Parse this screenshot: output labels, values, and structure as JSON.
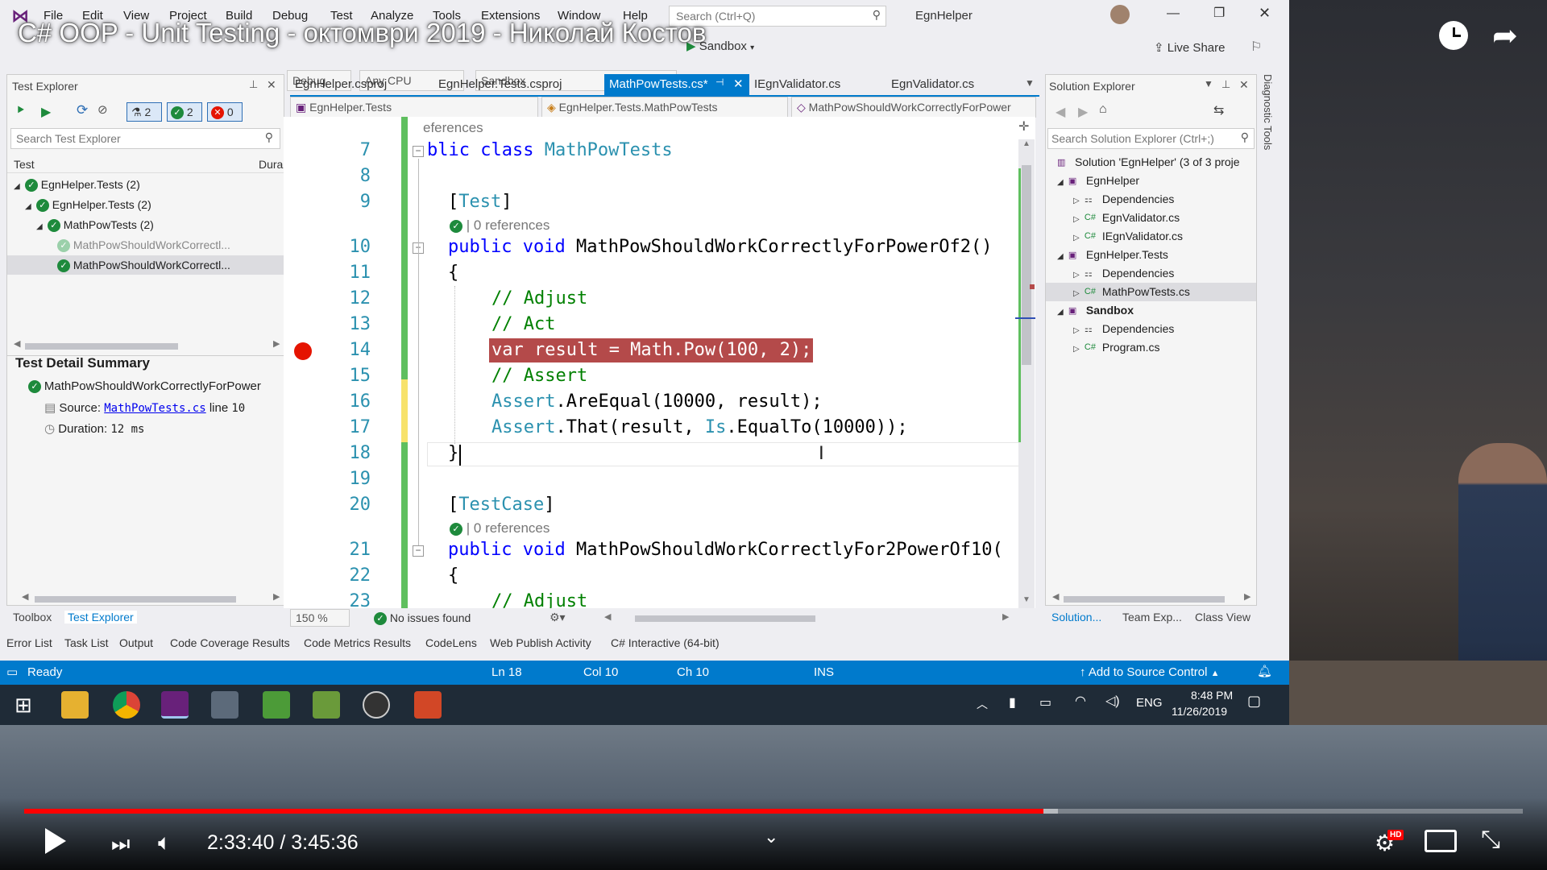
{
  "video": {
    "title": "C# OOP - Unit Testing - октомври 2019 - Николай Костов",
    "time_current": "2:33:40",
    "time_separator": "/",
    "time_total": "3:45:36",
    "progress_fraction": 0.68,
    "buffered_fraction": 0.69,
    "hd_badge": "HD"
  },
  "vs": {
    "menu": [
      "File",
      "Edit",
      "View",
      "Project",
      "Build",
      "Debug",
      "Test",
      "Analyze",
      "Tools",
      "Extensions",
      "Window",
      "Help"
    ],
    "search_placeholder": "Search (Ctrl+Q)",
    "solution_name": "EgnHelper",
    "toolbar": {
      "config": "Debug",
      "platform": "Any CPU",
      "startup": "Sandbox",
      "run_label": "Sandbox",
      "live_share": "Live Share"
    },
    "test_explorer": {
      "title": "Test Explorer",
      "count_total": "2",
      "count_passed": "2",
      "count_failed": "0",
      "search_placeholder": "Search Test Explorer",
      "col_test": "Test",
      "col_duration": "Dura",
      "tree": [
        {
          "label": "EgnHelper.Tests (2)"
        },
        {
          "label": "EgnHelper.Tests (2)"
        },
        {
          "label": "MathPowTests (2)"
        },
        {
          "label": "MathPowShouldWorkCorrectl..."
        },
        {
          "label": "MathPowShouldWorkCorrectl..."
        }
      ],
      "detail_title": "Test Detail Summary",
      "detail_test": "MathPowShouldWorkCorrectlyForPower",
      "detail_source_label": "Source:",
      "detail_source_file": "MathPowTests.cs",
      "detail_source_line_label": "line",
      "detail_source_line": "10",
      "detail_duration_label": "Duration:",
      "detail_duration": "12 ms"
    },
    "tabs": [
      {
        "label": "EgnHelper.csproj"
      },
      {
        "label": "EgnHelper.Tests.csproj"
      },
      {
        "label": "MathPowTests.cs*"
      },
      {
        "label": "IEgnValidator.cs"
      },
      {
        "label": "EgnValidator.cs"
      }
    ],
    "nav": {
      "project": "EgnHelper.Tests",
      "class": "EgnHelper.Tests.MathPowTests",
      "member": "MathPowShouldWorkCorrectlyForPower"
    },
    "editor": {
      "partial_top": "eferences",
      "lines": {
        "l7": "7",
        "l8": "8",
        "l9": "9",
        "l10": "10",
        "l11": "11",
        "l12": "12",
        "l13": "13",
        "l14": "14",
        "l15": "15",
        "l16": "16",
        "l17": "17",
        "l18": "18",
        "l19": "19",
        "l20": "20",
        "l21": "21",
        "l22": "22",
        "l23": "23"
      },
      "code": {
        "c7_kw": "blic class ",
        "c7_ty": "MathPowTests",
        "c9_open": "[",
        "c9_attr": "Test",
        "c9_close": "]",
        "c9_lens": "0 references",
        "c10_kw": "public void ",
        "c10_name": "MathPowShouldWorkCorrectlyForPowerOf2()",
        "c11": "{",
        "c12": "// Adjust",
        "c13": "// Act",
        "c14": "var result = Math.Pow(100, 2);",
        "c15": "// Assert",
        "c16_ty": "Assert",
        "c16_rest": ".AreEqual(10000, result);",
        "c17_ty": "Assert",
        "c17_mid": ".That(result, ",
        "c17_ty2": "Is",
        "c17_rest": ".EqualTo(10000));",
        "c18": "}",
        "c20_open": "[",
        "c20_attr": "TestCase",
        "c20_close": "]",
        "c20_lens": "0 references",
        "c21_kw": "public void ",
        "c21_name": "MathPowShouldWorkCorrectlyFor2PowerOf10(",
        "c22": "{",
        "c23": "// Adjust"
      },
      "zoom": "150 %",
      "issues": "No issues found",
      "lens_sep": "|"
    },
    "solution_explorer": {
      "title": "Solution Explorer",
      "search_placeholder": "Search Solution Explorer (Ctrl+;)",
      "items": [
        {
          "label": "Solution 'EgnHelper' (3 of 3 proje"
        },
        {
          "label": "EgnHelper"
        },
        {
          "label": "Dependencies"
        },
        {
          "label": "EgnValidator.cs"
        },
        {
          "label": "IEgnValidator.cs"
        },
        {
          "label": "EgnHelper.Tests"
        },
        {
          "label": "Dependencies"
        },
        {
          "label": "MathPowTests.cs"
        },
        {
          "label": "Sandbox"
        },
        {
          "label": "Dependencies"
        },
        {
          "label": "Program.cs"
        }
      ],
      "bottom_tabs": [
        "Solution...",
        "Team Exp...",
        "Class View"
      ],
      "diagnostic_tools": "Diagnostic Tools"
    },
    "left_bottom_tabs": [
      "Toolbox",
      "Test Explorer"
    ],
    "output_tabs": [
      "Error List",
      "Task List",
      "Output",
      "Code Coverage Results",
      "Code Metrics Results",
      "CodeLens",
      "Web Publish Activity",
      "C# Interactive (64-bit)"
    ],
    "status": {
      "ready": "Ready",
      "ln": "Ln 18",
      "col": "Col 10",
      "ch": "Ch 10",
      "ins": "INS",
      "source_control": "Add to Source Control"
    },
    "taskbar": {
      "lang": "ENG",
      "time": "8:48 PM",
      "date": "11/26/2019"
    }
  },
  "colors": {
    "accent_blue": "#007acc",
    "pass_green": "#1e8a3c",
    "fail_red": "#e51400",
    "breakpoint_red": "#e51400",
    "breakpoint_highlight": "#b44a4a",
    "youtube_red": "#ff0000"
  },
  "icons": {
    "play": "play-icon",
    "next": "next-icon",
    "volume": "volume-icon",
    "clock": "watch-later-icon",
    "share": "share-icon",
    "settings": "settings-icon",
    "cast": "cast-icon",
    "fullscreen_exit": "exit-fullscreen-icon",
    "chevron": "chevron-down-icon"
  }
}
